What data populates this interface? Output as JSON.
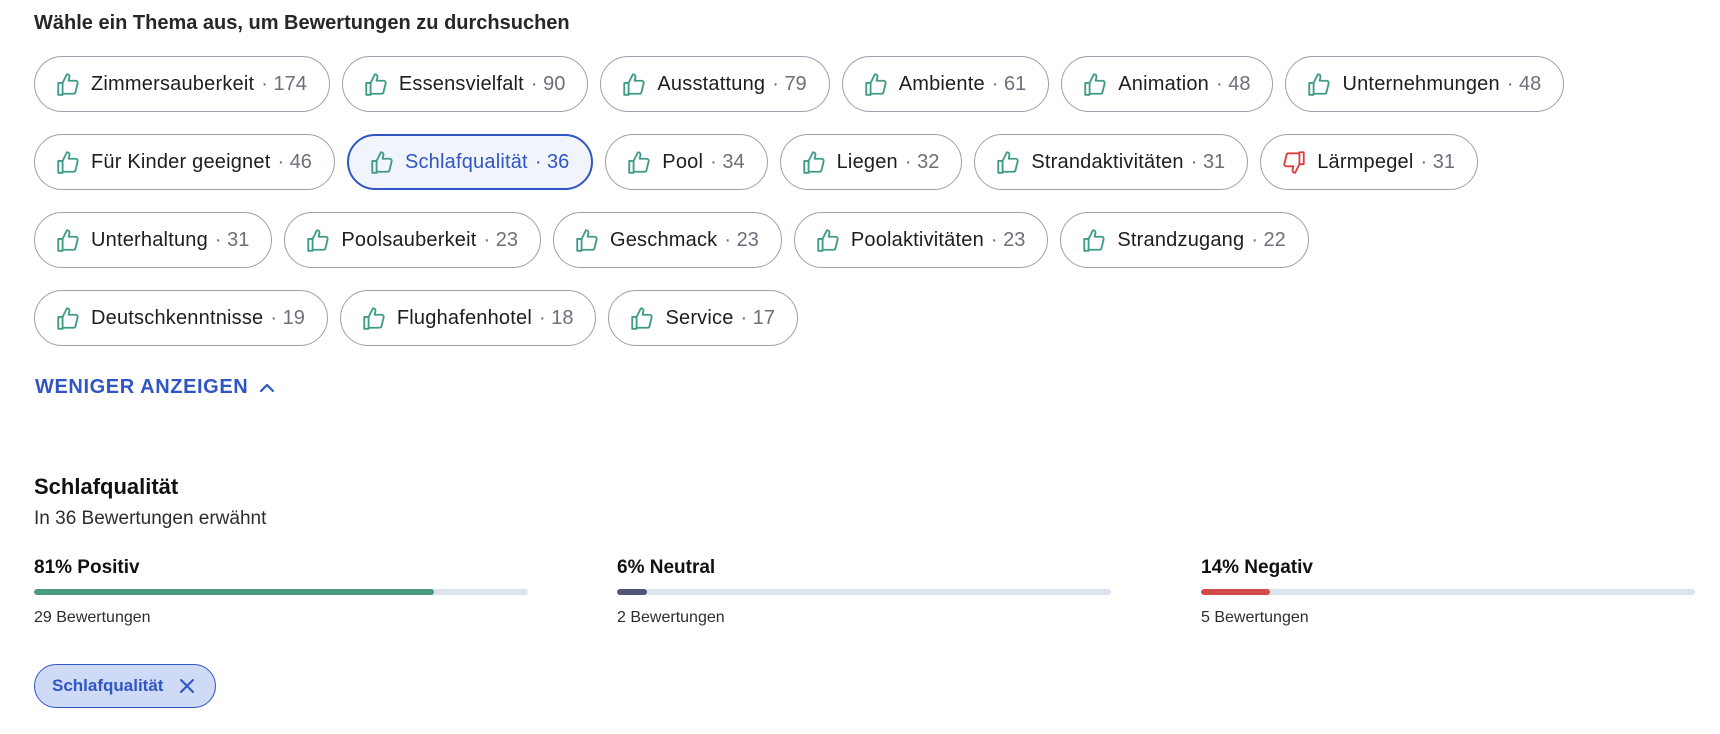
{
  "prompt": "Wähle ein Thema aus, um Bewertungen zu durchsuchen",
  "chip_rows": [
    [
      {
        "label": "Zimmersauberkeit",
        "count": "174",
        "sentiment": "thumbs-up",
        "selected": false
      },
      {
        "label": "Essensvielfalt",
        "count": "90",
        "sentiment": "thumbs-up",
        "selected": false
      },
      {
        "label": "Ausstattung",
        "count": "79",
        "sentiment": "thumbs-up",
        "selected": false
      },
      {
        "label": "Ambiente",
        "count": "61",
        "sentiment": "thumbs-up",
        "selected": false
      },
      {
        "label": "Animation",
        "count": "48",
        "sentiment": "thumbs-up",
        "selected": false
      },
      {
        "label": "Unternehmungen",
        "count": "48",
        "sentiment": "thumbs-up",
        "selected": false
      }
    ],
    [
      {
        "label": "Für Kinder geeignet",
        "count": "46",
        "sentiment": "thumbs-up",
        "selected": false
      },
      {
        "label": "Schlafqualität",
        "count": "36",
        "sentiment": "thumbs-up",
        "selected": true
      },
      {
        "label": "Pool",
        "count": "34",
        "sentiment": "thumbs-up",
        "selected": false
      },
      {
        "label": "Liegen",
        "count": "32",
        "sentiment": "thumbs-up",
        "selected": false
      },
      {
        "label": "Strandaktivitäten",
        "count": "31",
        "sentiment": "thumbs-up",
        "selected": false
      },
      {
        "label": "Lärmpegel",
        "count": "31",
        "sentiment": "thumbs-down",
        "selected": false
      }
    ],
    [
      {
        "label": "Unterhaltung",
        "count": "31",
        "sentiment": "thumbs-up",
        "selected": false
      },
      {
        "label": "Poolsauberkeit",
        "count": "23",
        "sentiment": "thumbs-up",
        "selected": false
      },
      {
        "label": "Geschmack",
        "count": "23",
        "sentiment": "thumbs-up",
        "selected": false
      },
      {
        "label": "Poolaktivitäten",
        "count": "23",
        "sentiment": "thumbs-up",
        "selected": false
      },
      {
        "label": "Strandzugang",
        "count": "22",
        "sentiment": "thumbs-up",
        "selected": false
      }
    ],
    [
      {
        "label": "Deutschkenntnisse",
        "count": "19",
        "sentiment": "thumbs-up",
        "selected": false
      },
      {
        "label": "Flughafenhotel",
        "count": "18",
        "sentiment": "thumbs-up",
        "selected": false
      },
      {
        "label": "Service",
        "count": "17",
        "sentiment": "thumbs-up",
        "selected": false
      }
    ]
  ],
  "toggle_label": "WENIGER ANZEIGEN",
  "topic": {
    "title": "Schlafqualität",
    "subtitle": "In 36 Bewertungen erwähnt"
  },
  "stats": [
    {
      "heading": "81% Positiv",
      "fraction": 0.81,
      "reviews": "29 Bewertungen",
      "color": "#4a9a83"
    },
    {
      "heading": "6% Neutral",
      "fraction": 0.06,
      "reviews": "2 Bewertungen",
      "color": "#4e5574"
    },
    {
      "heading": "14% Negativ",
      "fraction": 0.14,
      "reviews": "5 Bewertungen",
      "color": "#d14a47"
    }
  ],
  "active_filter": {
    "label": "Schlafqualität"
  },
  "colors": {
    "accent": "#2f56c4",
    "thumbs_up": "#3f9a86",
    "thumbs_down": "#d9413c"
  }
}
